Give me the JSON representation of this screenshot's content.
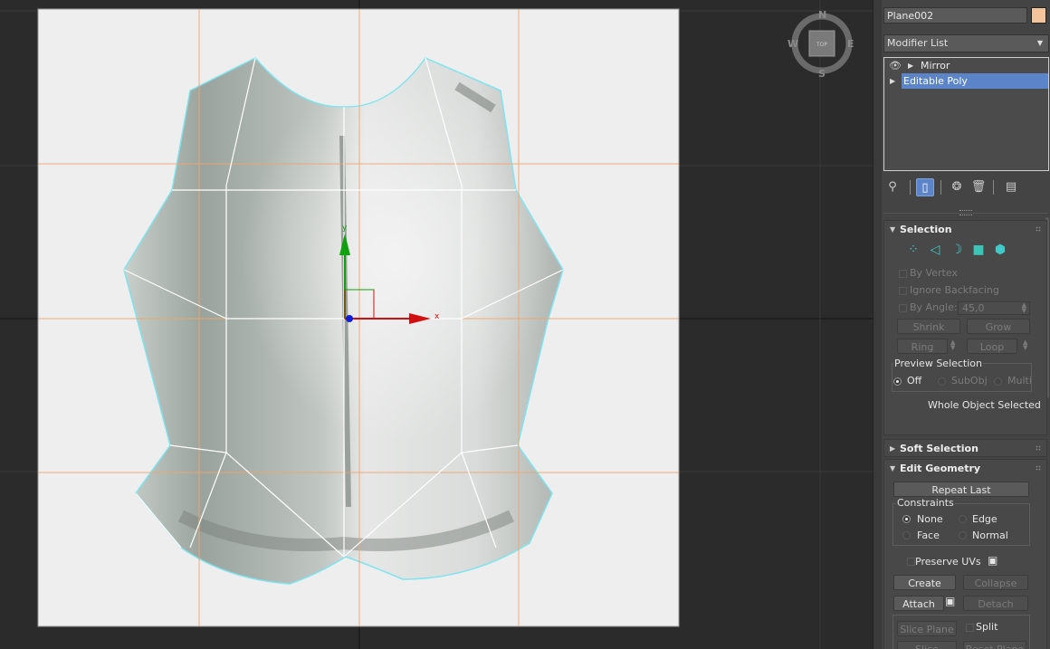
{
  "viewport": {
    "compass": {
      "north": "N",
      "south": "S",
      "east": "E",
      "west": "W",
      "view_cube_label": "TOP"
    },
    "gizmo": {
      "x_label": "x",
      "y_label": "y"
    }
  },
  "panel": {
    "object_name": "Plane002",
    "object_color": "#f4c49c",
    "modifier_list_label": "Modifier List",
    "stack": [
      {
        "label": "Mirror",
        "selected": false
      },
      {
        "label": "Editable Poly",
        "selected": true
      }
    ],
    "toolbar": {
      "pin_icon": "pin-stack-icon",
      "show_end_result_icon": "show-end-result-icon",
      "make_unique_icon": "make-unique-icon",
      "remove_modifier_icon": "remove-modifier-icon",
      "configure_sets_icon": "configure-modifier-sets-icon"
    },
    "selection": {
      "title": "Selection",
      "by_vertex": "By Vertex",
      "ignore_backfacing": "Ignore Backfacing",
      "by_angle": "By Angle:",
      "angle_value": "45,0",
      "shrink": "Shrink",
      "grow": "Grow",
      "ring": "Ring",
      "loop": "Loop",
      "preview_title": "Preview Selection",
      "preview_off": "Off",
      "preview_subobj": "SubObj",
      "preview_multi": "Multi",
      "status": "Whole Object Selected"
    },
    "soft_selection": {
      "title": "Soft Selection"
    },
    "edit_geometry": {
      "title": "Edit Geometry",
      "repeat_last": "Repeat Last",
      "constraints_title": "Constraints",
      "none": "None",
      "edge": "Edge",
      "face": "Face",
      "normal": "Normal",
      "preserve_uvs": "Preserve UVs",
      "create": "Create",
      "collapse": "Collapse",
      "attach": "Attach",
      "detach": "Detach",
      "slice_plane": "Slice Plane",
      "split": "Split",
      "slice": "Slice",
      "reset_plane": "Reset Plane"
    }
  }
}
